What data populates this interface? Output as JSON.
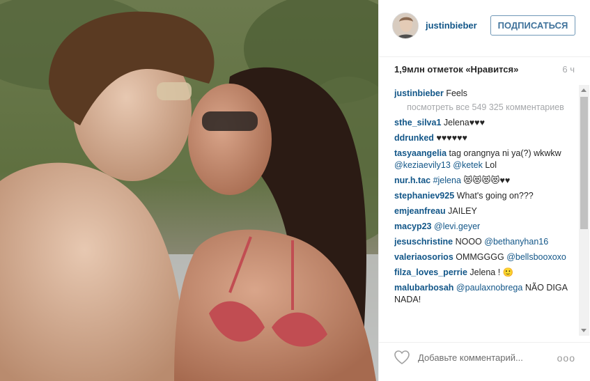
{
  "post": {
    "photo_icon": "couple-photo",
    "author": {
      "username": "justinbieber",
      "avatar_icon": "user-avatar-icon"
    },
    "follow_label": "ПОДПИСАТЬСЯ",
    "likes": "1,9млн отметок «Нравится»",
    "time": "6 ч",
    "caption": {
      "user": "justinbieber",
      "text": "Feels"
    },
    "view_all": "посмотреть все 549 325 комментариев",
    "comments": [
      {
        "user": "sthe_silva1",
        "text": "Jelena♥♥♥"
      },
      {
        "user": "ddrunked",
        "text": "♥♥♥♥♥♥"
      },
      {
        "user": "tasyaangelia",
        "text": "tag orangnya ni ya(?) wkwkw",
        "mentions": "@keziaevily13 @ketek",
        "tail": "Lol"
      },
      {
        "user": "nur.h.tac",
        "text": "",
        "mentions": "#jelena",
        "tail": "😻😻😻😻♥♥"
      },
      {
        "user": "stephaniev925",
        "text": "What's going on???"
      },
      {
        "user": "emjeanfreau",
        "text": "JAILEY"
      },
      {
        "user": "macyp23",
        "text": "",
        "mentions": "@levi.geyer"
      },
      {
        "user": "jesuschristine",
        "text": "NOOO",
        "mentions": "@bethanyhan16"
      },
      {
        "user": "valeriaosorios",
        "text": "OMMGGGG",
        "mentions": "@bellsbooxoxo"
      },
      {
        "user": "filza_loves_perrie",
        "text": "Jelena ! 🙂"
      },
      {
        "user": "malubarbosah",
        "text": "",
        "mentions": "@paulaxnobrega",
        "tail": "NÃO DIGA NADA!"
      }
    ],
    "add_comment_placeholder": "Добавьте комментарий...",
    "more_label": "ooo",
    "heart_icon": "heart-outline-icon",
    "more_icon": "more-options-icon"
  },
  "colors": {
    "link": "#125688",
    "follow_border": "#6f97b6",
    "muted": "#a5a7aa"
  }
}
